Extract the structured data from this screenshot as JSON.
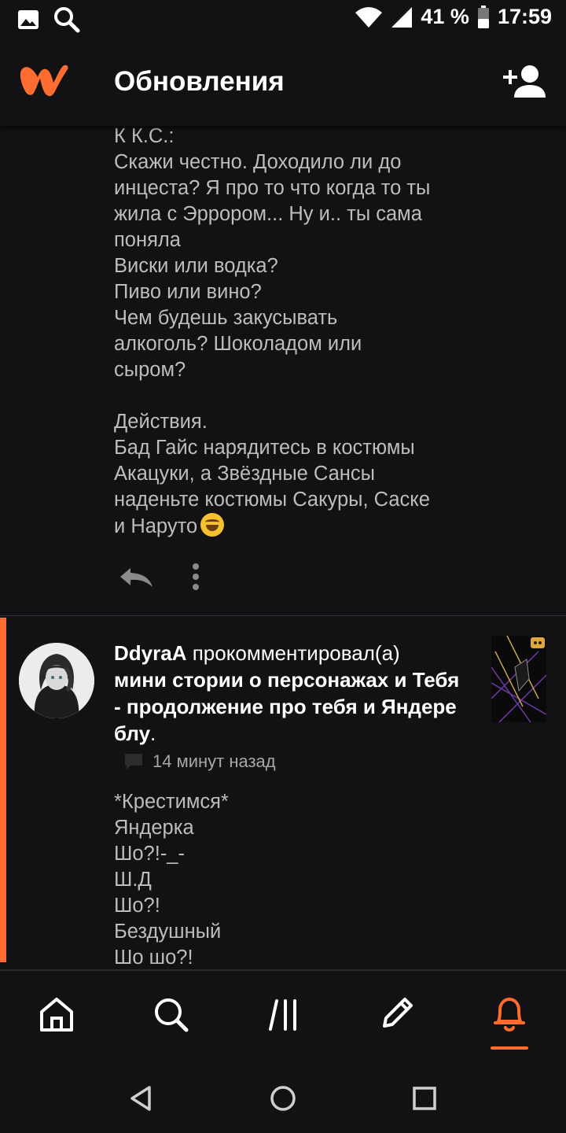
{
  "status_bar": {
    "battery": "41 %",
    "time": "17:59",
    "icons": [
      "image-icon",
      "search-icon",
      "wifi-icon",
      "signal-icon",
      "battery-icon"
    ]
  },
  "header": {
    "title": "Обновления",
    "logo_icon": "wattpad-logo",
    "action_icon": "add-user-icon"
  },
  "comment": {
    "lines": [
      "К К.С.:",
      "Скажи честно. Доходило ли до",
      "инцеста? Я про то что когда то ты",
      "жила с Эррором... Ну и.. ты сама",
      "поняла",
      "Виски или водка?",
      "Пиво или вино?",
      "Чем будешь закусывать",
      "алкоголь? Шоколадом или",
      "сыром?",
      "",
      "Действия.",
      "Бад Гайс нарядитесь в костюмы",
      "Акацуки, а Звёздные Сансы",
      "наденьте костюмы Сакуры, Саске"
    ],
    "last_line": "и Наруто",
    "emoji": "laughing-emoji",
    "actions": [
      "reply-icon",
      "more-icon"
    ]
  },
  "notification": {
    "user": "DdyraA",
    "verb": " прокомментировал(а)",
    "story_lines": [
      "мини стории о персонажах и Тебя",
      "- продолжение про тебя и Яндере",
      "блу"
    ],
    "period": ".",
    "time": "14 минут назад",
    "body_lines": [
      "*Крестимся*",
      "Яндерка",
      "Шо?!-_-",
      "Ш.Д",
      "Шо?!",
      "Бездушный",
      "Шо шо?!"
    ],
    "accent_color": "#ff6c2f"
  },
  "bottom_nav": {
    "items": [
      "home-icon",
      "search-icon",
      "library-icon",
      "write-icon",
      "notifications-icon"
    ],
    "active": "notifications-icon",
    "accent": "#ff6c2f"
  },
  "system_nav": [
    "back-icon",
    "home-circle-icon",
    "recents-icon"
  ]
}
